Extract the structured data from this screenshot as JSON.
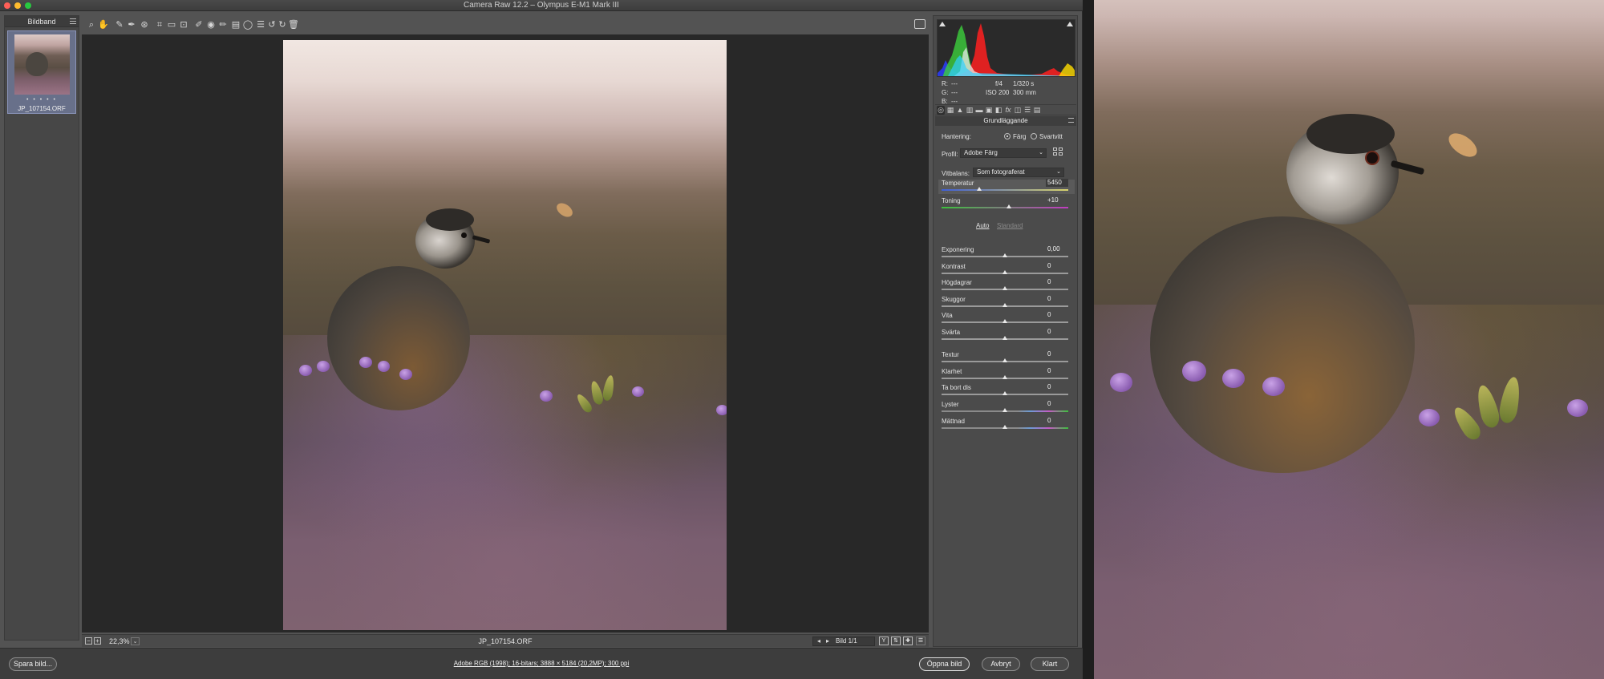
{
  "window": {
    "title": "Camera Raw 12.2  –  Olympus E-M1 Mark III"
  },
  "filmstrip": {
    "title": "Bildband",
    "thumbnail": {
      "rating": "• • • • •",
      "filename": "JP_107154.ORF"
    }
  },
  "toolbar": {
    "tools": [
      "zoom-icon",
      "hand-icon",
      "white-balance-icon",
      "color-sampler-icon",
      "targeted-adjust-icon",
      "crop-icon",
      "straighten-icon",
      "transform-icon",
      "spot-removal-icon",
      "red-eye-icon",
      "adjustment-brush-icon",
      "graduated-filter-icon",
      "radial-filter-icon",
      "presets-list-icon",
      "rotate-left-icon",
      "rotate-right-icon",
      "trash-icon"
    ]
  },
  "canvas_footer": {
    "zoom": "22,3%",
    "filename": "JP_107154.ORF",
    "image_counter": "Bild 1/1",
    "view_buttons": [
      "Y",
      "⇅",
      "✚"
    ]
  },
  "panel": {
    "rgb": {
      "r_label": "R:",
      "g_label": "G:",
      "b_label": "B:",
      "r": "---",
      "g": "---",
      "b": "---"
    },
    "exif": {
      "aperture": "f/4",
      "shutter": "1/320 s",
      "iso": "ISO 200",
      "focal": "300 mm"
    },
    "section_title": "Grundläggande",
    "treatment": {
      "label": "Hantering:",
      "option_color": "Färg",
      "option_bw": "Svartvitt",
      "selected": "Färg"
    },
    "profile": {
      "label": "Profil:",
      "value": "Adobe Färg"
    },
    "white_balance": {
      "label": "Vitbalans:",
      "value": "Som fotograferat"
    },
    "temperature": {
      "label": "Temperatur",
      "value": "5450",
      "fraction": 0.3
    },
    "tint": {
      "label": "Toning",
      "value": "+10",
      "fraction": 0.53
    },
    "auto_label": "Auto",
    "default_label": "Standard",
    "sliders_tone": [
      {
        "label": "Exponering",
        "value": "0,00",
        "fraction": 0.5
      },
      {
        "label": "Kontrast",
        "value": "0",
        "fraction": 0.5
      },
      {
        "label": "Högdagrar",
        "value": "0",
        "fraction": 0.5
      },
      {
        "label": "Skuggor",
        "value": "0",
        "fraction": 0.5
      },
      {
        "label": "Vita",
        "value": "0",
        "fraction": 0.5
      },
      {
        "label": "Svärta",
        "value": "0",
        "fraction": 0.5
      }
    ],
    "sliders_presence": [
      {
        "label": "Textur",
        "value": "0",
        "fraction": 0.5
      },
      {
        "label": "Klarhet",
        "value": "0",
        "fraction": 0.5
      },
      {
        "label": "Ta bort dis",
        "value": "0",
        "fraction": 0.5
      }
    ],
    "sliders_color": [
      {
        "label": "Lyster",
        "value": "0",
        "fraction": 0.5
      },
      {
        "label": "Mättnad",
        "value": "0",
        "fraction": 0.5
      }
    ]
  },
  "bottom": {
    "save_label": "Spara bild...",
    "workflow": "Adobe RGB (1998); 16-bitars; 3888 × 5184 (20,2MP); 300 ppi",
    "open_label": "Öppna bild",
    "cancel_label": "Avbryt",
    "done_label": "Klart"
  },
  "colors": {
    "window_bg": "#535353",
    "canvas_bg": "#282828",
    "panel_bg": "#4b4b4b",
    "traffic_close": "#fe5f57",
    "traffic_min": "#febc2e",
    "traffic_max": "#28c840"
  }
}
